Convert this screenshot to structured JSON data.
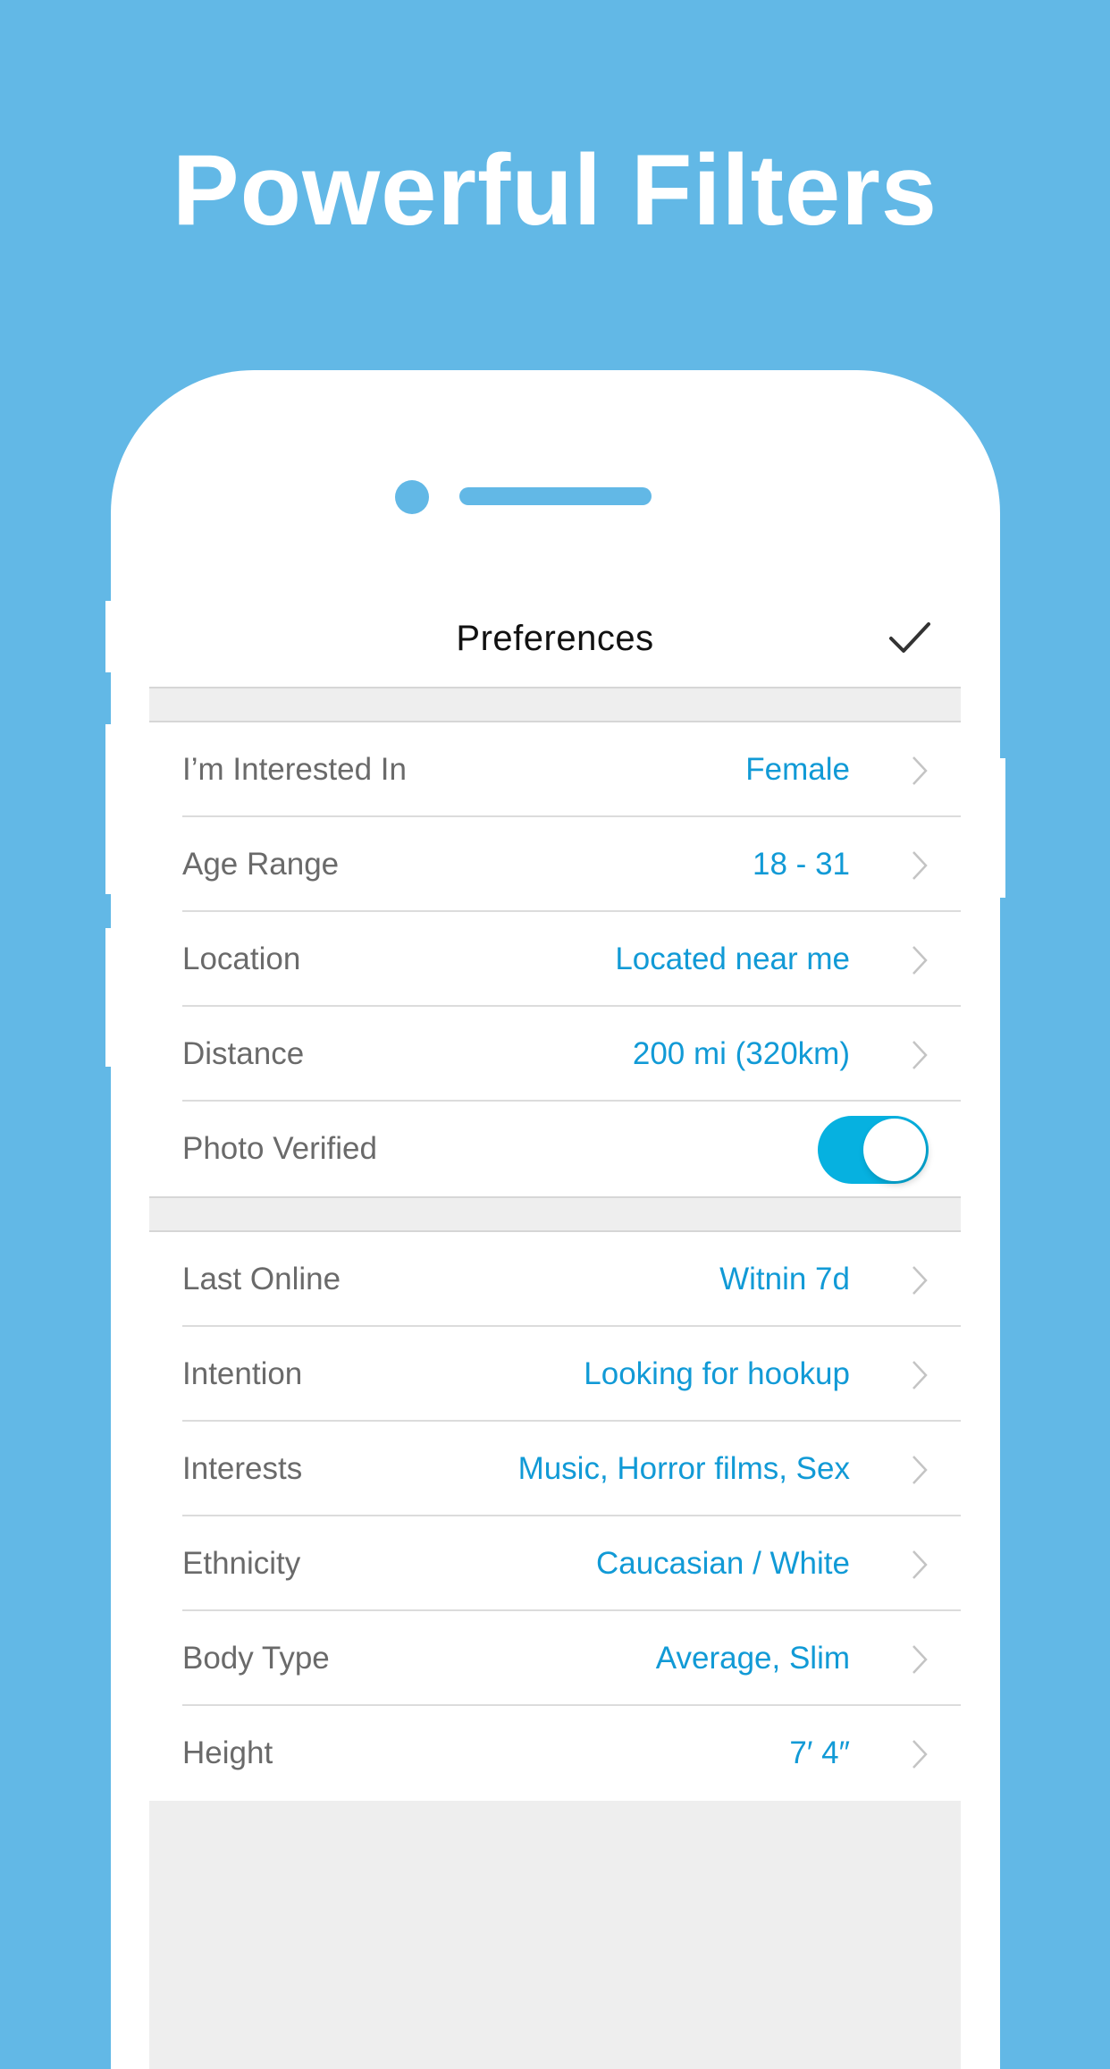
{
  "headline": "Powerful Filters",
  "colors": {
    "background": "#62b8e6",
    "accent_value": "#119ad6",
    "toggle_on": "#06b1e0",
    "label": "#6a6a6a"
  },
  "navbar": {
    "title": "Preferences",
    "done_icon": "checkmark-icon"
  },
  "sections": [
    {
      "rows": [
        {
          "label": "I’m Interested In",
          "value": "Female",
          "type": "disclosure"
        },
        {
          "label": "Age Range",
          "value": "18 - 31",
          "type": "disclosure"
        },
        {
          "label": "Location",
          "value": "Located near me",
          "type": "disclosure"
        },
        {
          "label": "Distance",
          "value": "200 mi (320km)",
          "type": "disclosure"
        },
        {
          "label": "Photo Verified",
          "value": "on",
          "type": "toggle"
        }
      ]
    },
    {
      "rows": [
        {
          "label": "Last Online",
          "value": "Witnin 7d",
          "type": "disclosure"
        },
        {
          "label": "Intention",
          "value": "Looking for hookup",
          "type": "disclosure"
        },
        {
          "label": "Interests",
          "value": "Music, Horror films, Sex",
          "type": "disclosure"
        },
        {
          "label": "Ethnicity",
          "value": "Caucasian / White",
          "type": "disclosure"
        },
        {
          "label": "Body Type",
          "value": "Average, Slim",
          "type": "disclosure"
        },
        {
          "label": "Height",
          "value": "7′ 4″",
          "type": "disclosure"
        }
      ]
    }
  ]
}
